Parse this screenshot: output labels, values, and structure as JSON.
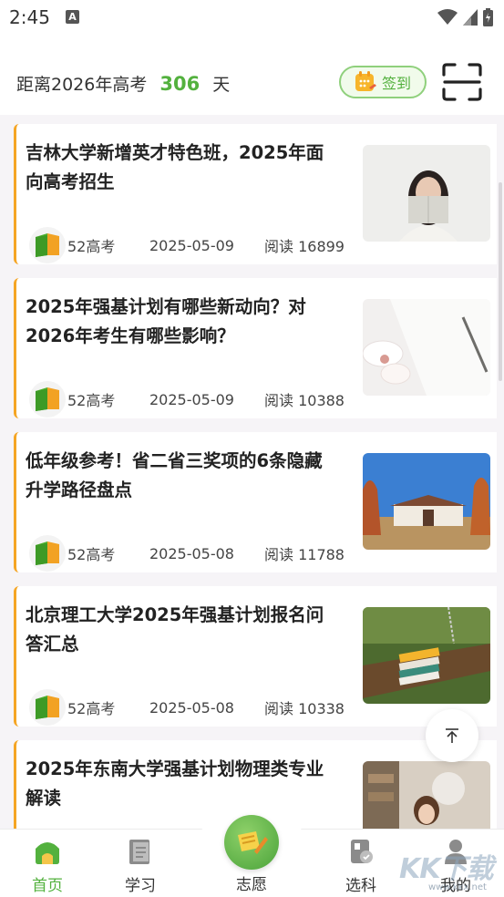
{
  "status_bar": {
    "time": "2:45"
  },
  "header": {
    "countdown_prefix": "距离2026年高考",
    "countdown_days": "306",
    "countdown_suffix": "天",
    "checkin_label": "签到",
    "accent": "#53b13e"
  },
  "articles": [
    {
      "title": "吉林大学新增英才特色班，2025年面向高考招生",
      "source": "52高考",
      "date": "2025-05-09",
      "reads": "阅读 16899",
      "thumb": "woman-reading-book"
    },
    {
      "title": "2025年强基计划有哪些新动向？对2026年考生有哪些影响？",
      "source": "52高考",
      "date": "2025-05-09",
      "reads": "阅读 10388",
      "thumb": "notebook-flowers-pen"
    },
    {
      "title": "低年级参考！省二省三奖项的6条隐藏升学路径盘点",
      "source": "52高考",
      "date": "2025-05-08",
      "reads": "阅读 11788",
      "thumb": "campus-building"
    },
    {
      "title": "北京理工大学2025年强基计划报名问答汇总",
      "source": "52高考",
      "date": "2025-05-08",
      "reads": "阅读 10338",
      "thumb": "books-on-swing"
    },
    {
      "title": "2025年东南大学强基计划物理类专业解读",
      "source": "",
      "date": "",
      "reads": "",
      "thumb": "students-studying"
    }
  ],
  "nav": [
    {
      "label": "首页",
      "icon": "home-icon",
      "active": true
    },
    {
      "label": "学习",
      "icon": "book-icon",
      "active": false
    },
    {
      "label": "志愿",
      "icon": "application-icon",
      "active": false
    },
    {
      "label": "选科",
      "icon": "subject-select-icon",
      "active": false
    },
    {
      "label": "我的",
      "icon": "profile-icon",
      "active": false
    }
  ],
  "watermark": {
    "main": "KK下载",
    "sub": "www.kkx.net"
  }
}
